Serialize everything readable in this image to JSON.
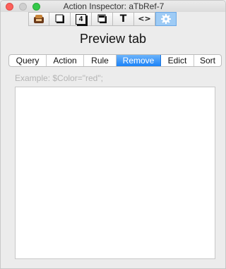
{
  "window": {
    "title": "Action Inspector: aTbRef-7"
  },
  "toolbar": {
    "buttons": [
      {
        "icon": "note-box-icon"
      },
      {
        "icon": "note-window-icon"
      },
      {
        "icon": "number-badge-icon",
        "label": "4"
      },
      {
        "icon": "shadow-box-icon"
      },
      {
        "icon": "text-icon",
        "label": "T"
      },
      {
        "icon": "code-icon",
        "label": "<>"
      },
      {
        "icon": "gear-icon",
        "selected": true
      }
    ]
  },
  "panel": {
    "heading": "Preview tab"
  },
  "tabs": [
    {
      "label": "Query"
    },
    {
      "label": "Action"
    },
    {
      "label": "Rule"
    },
    {
      "label": "Remove",
      "active": true
    },
    {
      "label": "Edict"
    },
    {
      "label": "Sort"
    }
  ],
  "editor": {
    "placeholder": "Example: $Color=\"red\";",
    "value": ""
  },
  "colors": {
    "accent": "#1c82f7",
    "close": "#fc605b",
    "zoom": "#34c84a"
  }
}
